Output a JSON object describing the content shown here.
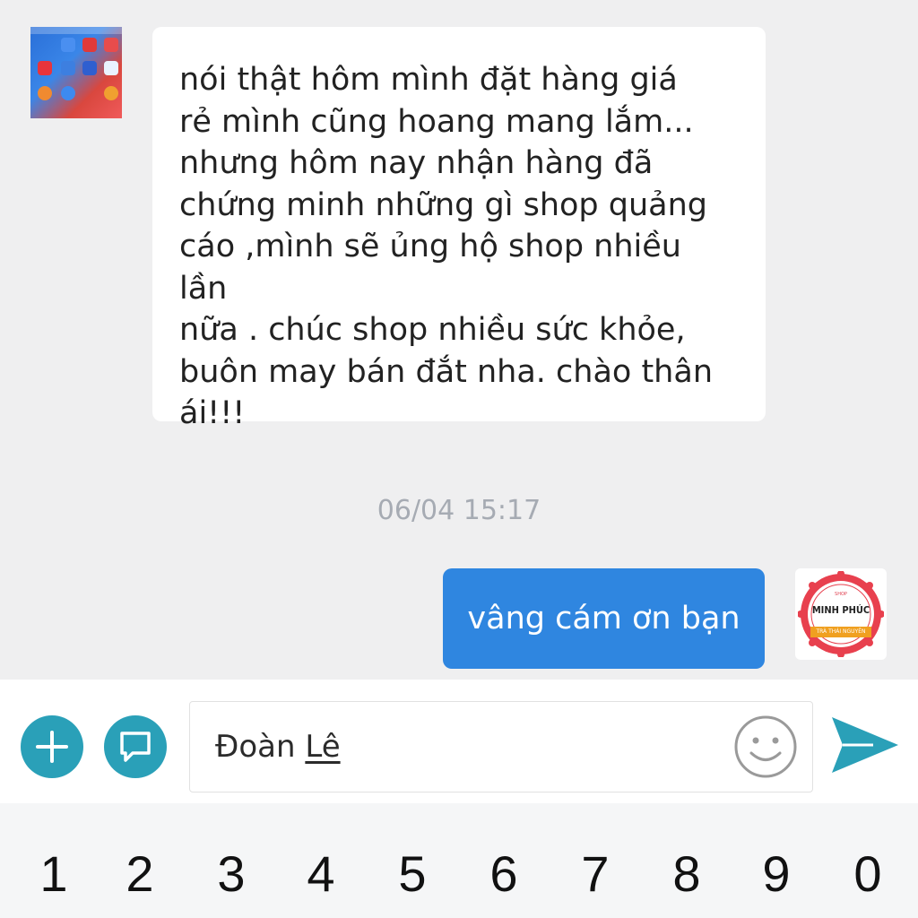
{
  "messages": {
    "incoming_lines": [
      "nói thật hôm mình đặt hàng giá",
      "rẻ mình cũng hoang mang lắm...",
      "nhưng hôm nay nhận hàng đã",
      "chứng minh những gì shop quảng",
      "cáo ,mình sẽ ủng hộ shop nhiều lần",
      "nữa . chúc shop nhiều sức khỏe,",
      "buôn may bán đắt nha. chào thân",
      "ái!!!"
    ],
    "timestamp": "06/04 15:17",
    "outgoing_text": "vâng cám ơn bạn"
  },
  "shop_avatar": {
    "name": "MINH PHÚC",
    "subtitle": "TRÀ THÁI NGUYÊN",
    "top_small": "SHOP"
  },
  "composer": {
    "value_part1": "Đoàn ",
    "value_part2": "Lê"
  },
  "keyboard": {
    "keys": [
      "1",
      "2",
      "3",
      "4",
      "5",
      "6",
      "7",
      "8",
      "9",
      "0"
    ]
  },
  "colors": {
    "outgoing_bubble": "#2f86e0",
    "accent": "#2aa0b8",
    "timestamp": "#a6abb3",
    "background": "#efeff0"
  },
  "icons": {
    "plus": "plus-icon",
    "message": "message-icon",
    "emoji": "smiley-icon",
    "send": "send-icon"
  }
}
